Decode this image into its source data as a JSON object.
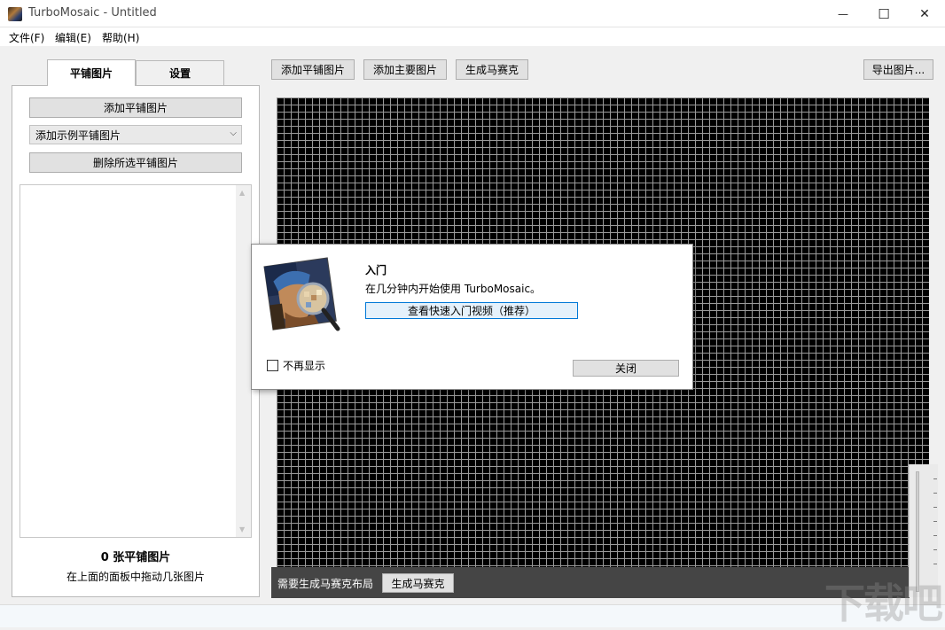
{
  "window": {
    "title": "TurboMosaic - Untitled",
    "minimize_glyph": "—",
    "maximize_glyph": "☐",
    "close_glyph": "✕"
  },
  "menu": {
    "items": [
      "文件(F)",
      "编辑(E)",
      "帮助(H)"
    ]
  },
  "left_tabs": [
    "平铺图片",
    "设置"
  ],
  "left_panel": {
    "add_tiles_button": "添加平铺图片",
    "sample_select_value": "添加示例平铺图片",
    "delete_selected_button": "删除所选平铺图片",
    "tile_count": "0 张平铺图片",
    "hint": "在上面的面板中拖动几张图片"
  },
  "toolbar": {
    "add_tiles": "添加平铺图片",
    "add_main": "添加主要图片",
    "generate": "生成马赛克",
    "export": "导出图片..."
  },
  "status": {
    "text": "需要生成马赛克布局",
    "generate_button": "生成马赛克"
  },
  "dialog": {
    "title": "入门",
    "subtitle": "在几分钟内开始使用 TurboMosaic。",
    "video_button": "查看快速入门视频（推荐）",
    "dont_show_label": "不再显示",
    "dont_show_checked": false,
    "close_button": "关闭"
  },
  "watermark": "下载吧",
  "colors": {
    "canvas": "#000000",
    "grid": "#9a9a9a",
    "status_bar": "#454545",
    "dialog_focus": "#0078d7"
  },
  "icons": {
    "app": "turbomosaic-app-icon",
    "dialog": "mosaic-magnifier-icon",
    "combo": "chevron-down-icon"
  }
}
